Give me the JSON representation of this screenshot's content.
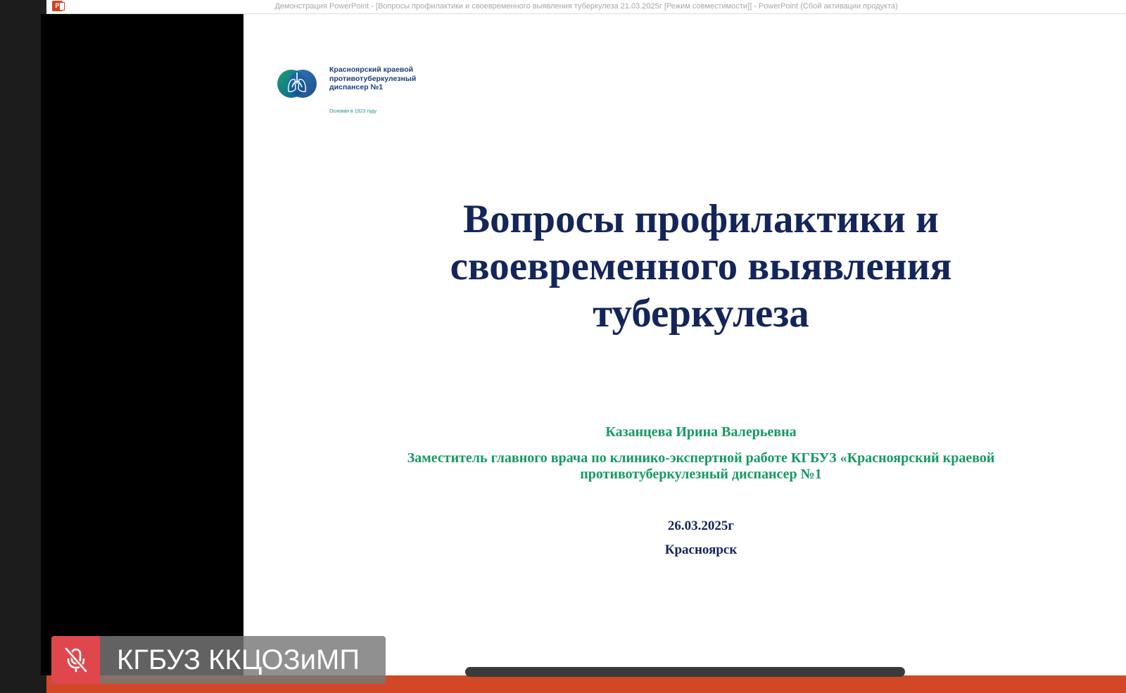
{
  "window": {
    "app_icon_label": "P",
    "title": "Демонстрация PowerPoint - [Вопросы профилактики и своевременного выявления туберкулеза 21.03.2025г [Режим совместимости]] - PowerPoint (Сбой активации продукта)"
  },
  "slide": {
    "logo": {
      "name_line1": "Красноярский краевой",
      "name_line2": "противотуберкулезный",
      "name_line3": "диспансер №1",
      "founded": "Основан в 1923 году",
      "colors": [
        "#1c6fb5",
        "#1aa071",
        "#0f5a9e"
      ]
    },
    "title_line1": "Вопросы профилактики и",
    "title_line2": "своевременного выявления",
    "title_line3": "туберкулеза",
    "author": "Казанцева Ирина Валерьевна",
    "position_line1": "Заместитель главного врача по клинико-экспертной работе КГБУЗ «Красноярский краевой",
    "position_line2": "противотуберкулезный диспансер №1",
    "date": "26.03.2025г",
    "city": "Красноярск"
  },
  "participant": {
    "name": "КГБУЗ ККЦОЗиМП",
    "mic_state": "muted",
    "mic_icon": "mic-off-icon",
    "badge_color": "#e0474c"
  },
  "colors": {
    "title": "#14255a",
    "subtitle_green": "#149a63",
    "powerpoint_orange": "#d24726"
  }
}
